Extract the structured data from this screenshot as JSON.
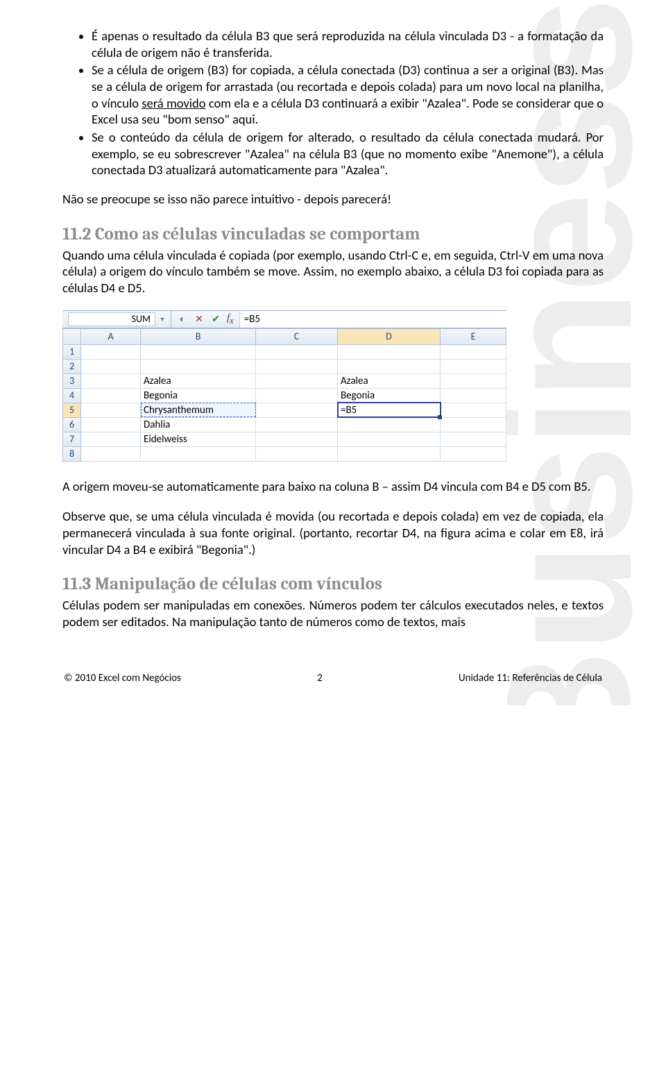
{
  "bullets": [
    {
      "text": "É apenas o resultado da célula B3 que será reproduzida na célula vinculada D3 - a formatação da célula de origem não é transferida."
    },
    {
      "text": "Se a célula de origem (B3) for copiada, a célula conectada (D3) continua a ser a original (B3). Mas se a célula de origem for arrastada (ou recortada e depois colada) para um novo local na planilha, o vínculo ",
      "u": "será movido",
      "text2": " com ela e a célula D3 continuará a exibir \"Azalea\". Pode se considerar que o Excel usa seu \"bom senso\" aqui."
    },
    {
      "text": "Se o conteúdo da célula de origem for alterado, o resultado da célula conectada mudará. Por exemplo, se eu sobrescrever \"Azalea\" na célula B3 (que no momento exibe \"Anemone\"), a célula conectada D3 atualizará automaticamente para \"Azalea\"."
    }
  ],
  "p_intro_after": "Não se preocupe se isso não parece intuitivo - depois parecerá!",
  "h2_112": "11.2 Como as células vinculadas se comportam",
  "p_112a": "Quando uma célula vinculada é copiada (por exemplo, usando Ctrl-C e, em seguida, Ctrl-V em uma nova célula) a origem do vínculo também se move.  Assim, no exemplo abaixo, a célula D3 foi copiada para as células D4 e D5.",
  "p_112b": "A origem moveu-se automaticamente para baixo na coluna B – assim D4 vincula com B4 e D5 com B5.",
  "p_112c": "Observe que, se uma célula vinculada é movida (ou recortada e depois colada) em vez de copiada, ela permanecerá vinculada à sua fonte original. (portanto, recortar D4, na figura acima e colar em E8, irá vincular D4 a B4 e exibirá \"Begonia\".)",
  "h2_113": "11.3 Manipulação de células com vínculos",
  "p_113": "Células podem ser manipuladas em conexões. Números podem ter cálculos executados neles, e textos podem ser editados. Na manipulação tanto de números como de textos, mais",
  "excel": {
    "namebox": "SUM",
    "formula": "=B5",
    "cols": [
      "A",
      "B",
      "C",
      "D",
      "E"
    ],
    "rows": [
      {
        "n": "1",
        "B": "",
        "D": ""
      },
      {
        "n": "2",
        "B": "",
        "D": ""
      },
      {
        "n": "3",
        "B": "Azalea",
        "D": "Azalea"
      },
      {
        "n": "4",
        "B": "Begonia",
        "D": "Begonia"
      },
      {
        "n": "5",
        "B": "Chrysanthemum",
        "D": "=B5",
        "active": true
      },
      {
        "n": "6",
        "B": "Dahlia",
        "D": ""
      },
      {
        "n": "7",
        "B": "Eidelweiss",
        "D": ""
      },
      {
        "n": "8",
        "B": "",
        "D": ""
      }
    ]
  },
  "footer": {
    "left": "© 2010 Excel com Negócios",
    "center": "2",
    "right": "Unidade 11: Referências de Célula"
  }
}
